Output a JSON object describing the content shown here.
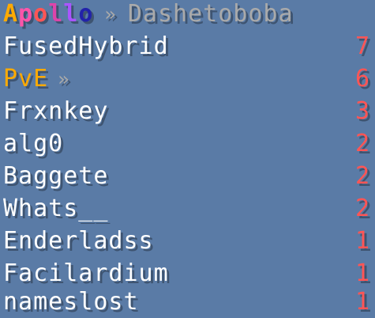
{
  "colors": {
    "background": "#5a7ba6",
    "player_name": "#ffffff",
    "score": "#ff5555",
    "mode": "#ffaa00",
    "server_name": "#aaaaaa",
    "separator": "#aaaaaa"
  },
  "header": {
    "brand_letters": [
      {
        "char": "A",
        "color": "#ffaa00"
      },
      {
        "char": "p",
        "color": "#ff55aa"
      },
      {
        "char": "o",
        "color": "#ff5555"
      },
      {
        "char": "l",
        "color": "#dd44aa"
      },
      {
        "char": "l",
        "color": "#aa55ff"
      },
      {
        "char": "o",
        "color": "#2222aa"
      }
    ],
    "separator": "»",
    "server_name": "Dashetoboba"
  },
  "rows": [
    {
      "name": "FusedHybrid",
      "score": "7"
    },
    {
      "name": "PvE",
      "score": "6",
      "is_mode": true,
      "separator": "»"
    },
    {
      "name": "Frxnkey",
      "score": "3"
    },
    {
      "name": "alg0",
      "score": "2"
    },
    {
      "name": "Baggete",
      "score": "2"
    },
    {
      "name": "Whats__",
      "score": "2"
    },
    {
      "name": "Enderladss",
      "score": "1"
    },
    {
      "name": "Facilardium",
      "score": "1"
    },
    {
      "name": "nameslost",
      "score": "1"
    }
  ]
}
